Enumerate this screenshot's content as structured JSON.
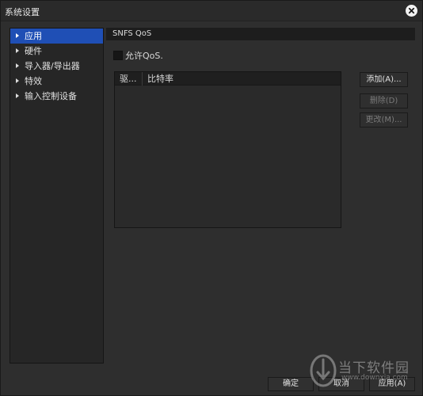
{
  "window": {
    "title": "系统设置"
  },
  "sidebar": {
    "items": [
      {
        "label": "应用",
        "active": true
      },
      {
        "label": "硬件",
        "active": false
      },
      {
        "label": "导入器/导出器",
        "active": false
      },
      {
        "label": "特效",
        "active": false
      },
      {
        "label": "输入控制设备",
        "active": false
      }
    ]
  },
  "section": {
    "title": "SNFS QoS"
  },
  "qos": {
    "checkbox_label": "允许QoS.",
    "checked": false
  },
  "table": {
    "columns": [
      "驱...",
      "比特率"
    ],
    "rows": []
  },
  "side_buttons": {
    "add": "添加(A)...",
    "delete": "删除(D)",
    "modify": "更改(M)..."
  },
  "footer": {
    "ok": "确定",
    "cancel": "取消",
    "apply": "应用(A)"
  },
  "watermark": {
    "text": "当下软件园",
    "url": "www.downxia.com"
  },
  "colors": {
    "active_item": "#1f4fb5",
    "background": "#2e2e2e"
  }
}
